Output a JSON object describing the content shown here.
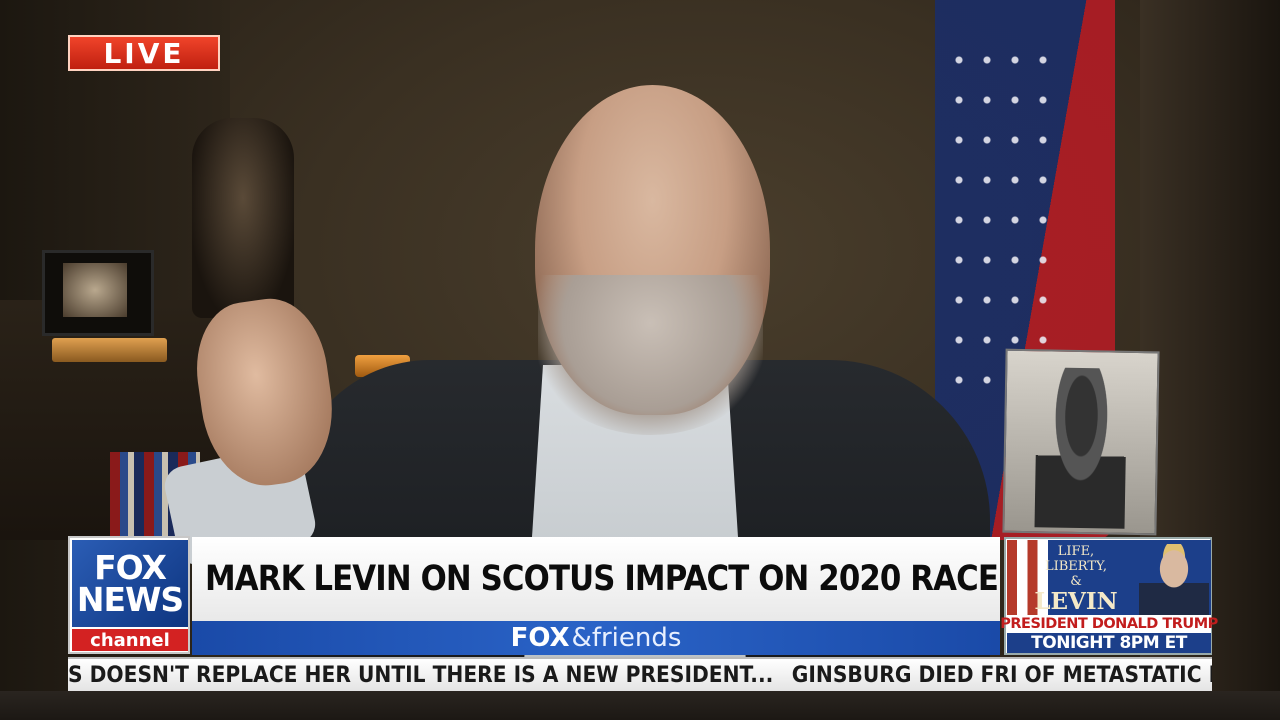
{
  "live_badge": "LIVE",
  "channel_logo": {
    "line1": "FOX",
    "line2": "NEWS",
    "line3": "channel"
  },
  "headline": "MARK LEVIN ON SCOTUS IMPACT ON 2020 RACE",
  "show": {
    "brand": "FOX",
    "name": "&friends"
  },
  "promo": {
    "title_line1": "LIFE,",
    "title_line2": "LIBERTY,",
    "title_line3": "&",
    "title_line4": "LEVIN",
    "guest": "PRESIDENT DONALD TRUMP",
    "time": "TONIGHT 8PM ET"
  },
  "ticker": {
    "items": [
      "S DOESN'T REPLACE HER UNTIL THERE IS A NEW PRESIDENT...",
      "GINSBURG DIED FRI OF METASTATIC PANCRE"
    ]
  },
  "colors": {
    "live_red": "#e0341e",
    "fox_blue": "#1a4aa8",
    "promo_red": "#c21d1d"
  }
}
